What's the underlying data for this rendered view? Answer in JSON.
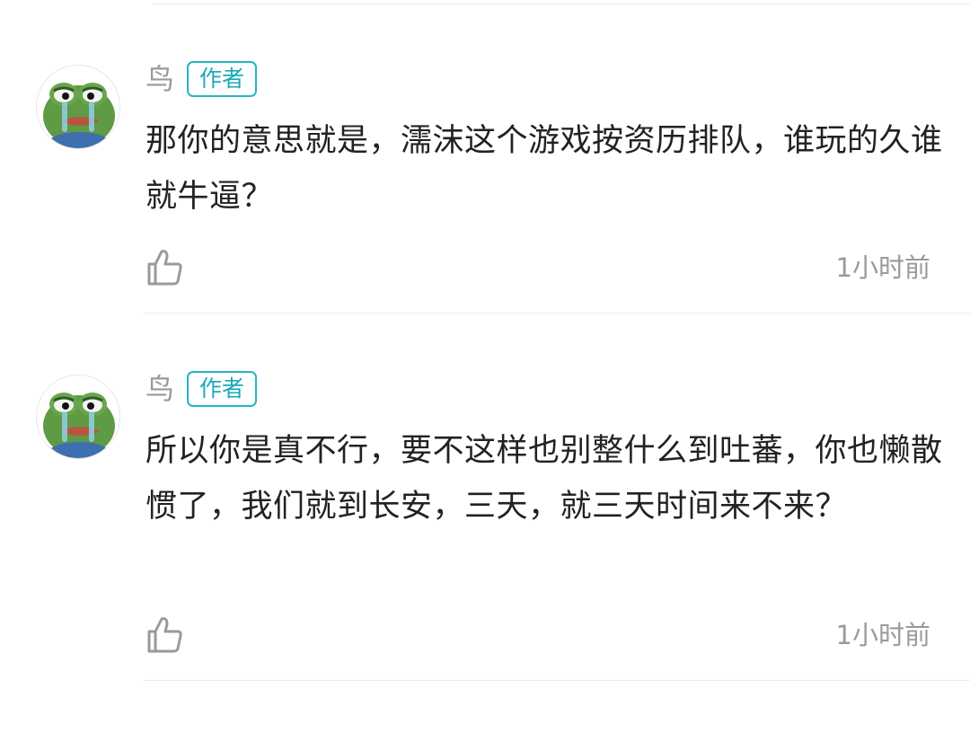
{
  "comments": [
    {
      "author": "鸟",
      "badge": "作者",
      "avatar": "crying-frog-avatar",
      "text": "那你的意思就是，濡沫这个游戏按资历排队，谁玩的久谁就牛逼？",
      "like_icon": "thumbs-up-icon",
      "time": "1小时前"
    },
    {
      "author": "鸟",
      "badge": "作者",
      "avatar": "crying-frog-avatar",
      "text": "所以你是真不行，要不这样也别整什么到吐蕃，你也懒散惯了，我们就到长安，三天，就三天时间来不来？",
      "like_icon": "thumbs-up-icon",
      "time": "1小时前"
    }
  ],
  "colors": {
    "badge_accent": "#26b5c4",
    "muted_text": "#9a9a9a",
    "body_text": "#222222",
    "divider": "#ececec"
  }
}
